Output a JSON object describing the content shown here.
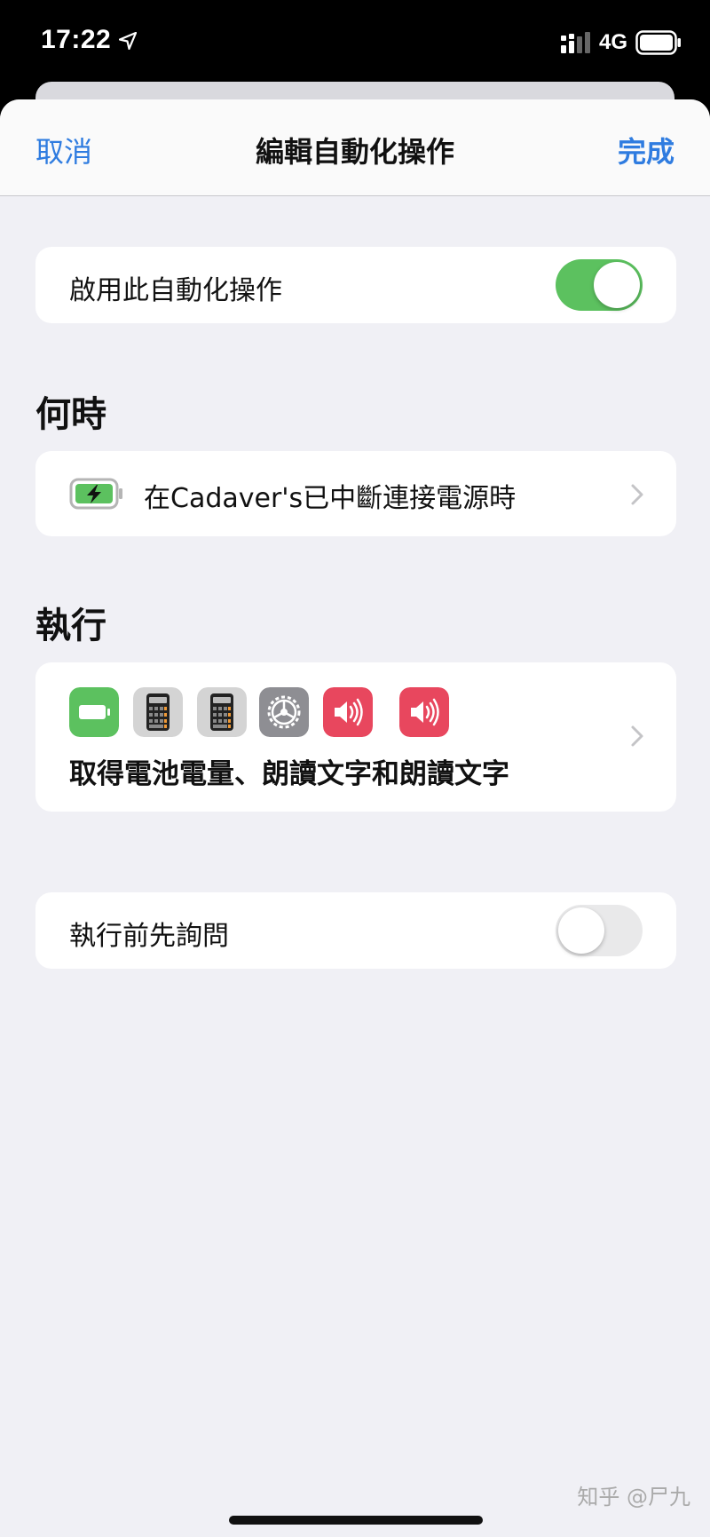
{
  "status_bar": {
    "time": "17:22",
    "network": "4G"
  },
  "nav": {
    "cancel_label": "取消",
    "title": "編輯自動化操作",
    "done_label": "完成"
  },
  "enable": {
    "label": "啟用此自動化操作",
    "enabled": true
  },
  "when": {
    "header": "何時",
    "trigger_text": "在Cadaver's已中斷連接電源時",
    "icon": "charging-battery-icon"
  },
  "do": {
    "header": "執行",
    "summary": "取得電池電量、朗讀文字和朗讀文字",
    "action_icons": [
      {
        "name": "battery-icon",
        "color": "#5cc15f"
      },
      {
        "name": "calculator-icon",
        "color": "#d4d4d4"
      },
      {
        "name": "calculator-icon",
        "color": "#d4d4d4"
      },
      {
        "name": "settings-gear-icon",
        "color": "#8e8e93"
      },
      {
        "name": "speaker-icon",
        "color": "#e8475e"
      },
      {
        "name": "speaker-icon",
        "color": "#e8475e"
      }
    ]
  },
  "ask": {
    "label": "執行前先詢問",
    "enabled": false
  },
  "watermark": "知乎 @尸九",
  "colors": {
    "accent": "#2f7ce0",
    "toggle_on": "#5cc15f",
    "background": "#f0f0f5"
  }
}
